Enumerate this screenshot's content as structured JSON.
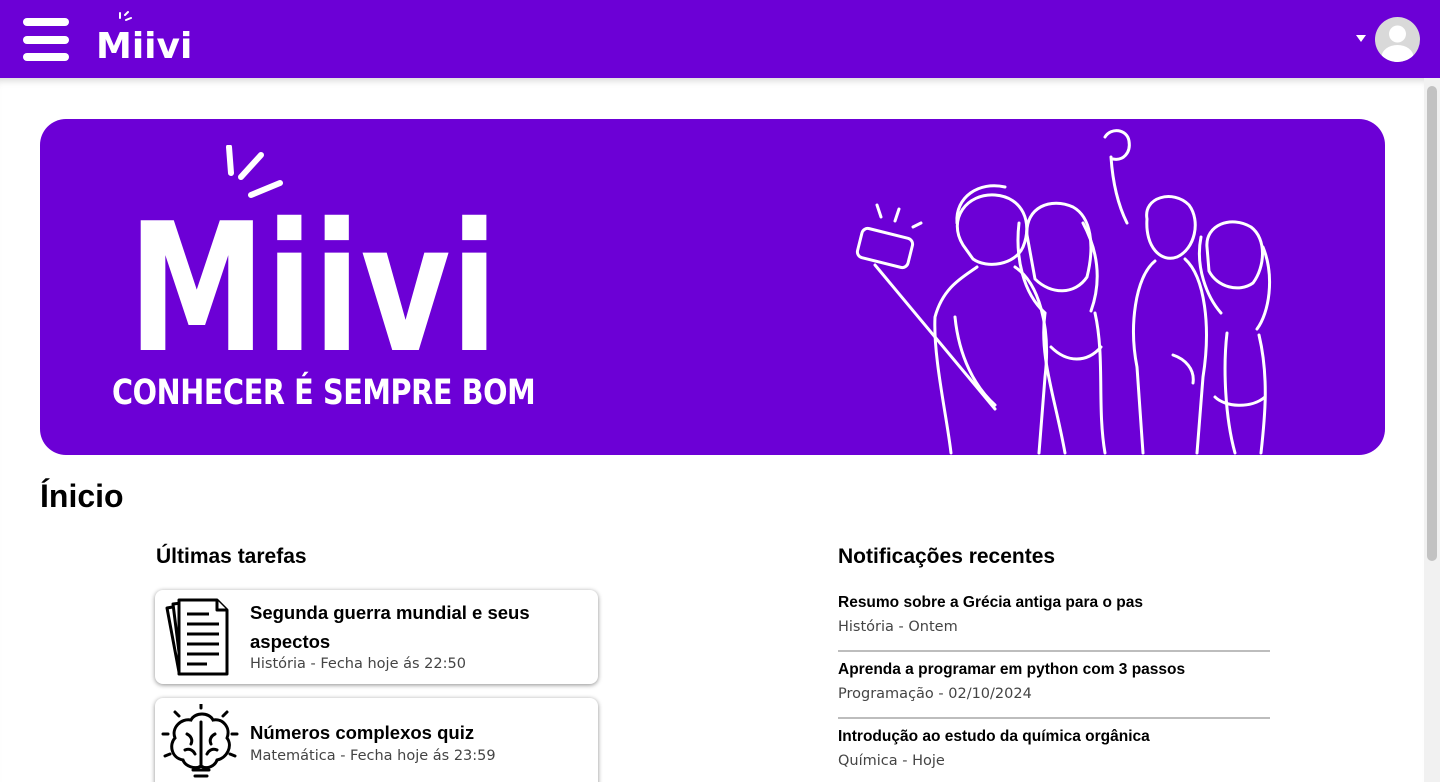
{
  "colors": {
    "brand": "#6c00d6",
    "text": "#111111",
    "muted": "#444444"
  },
  "header": {
    "menu_icon": "hamburger-menu-icon",
    "logo_text": "Miivi",
    "user_menu_icon": "caret-down-icon",
    "avatar_icon": "user-avatar-icon"
  },
  "banner": {
    "logo_text": "Miivi",
    "tagline": "CONHECER É SEMPRE BOM",
    "illustration": "friends-selfie-illustration"
  },
  "page_title": "Ínicio",
  "tasks": {
    "title": "Últimas tarefas",
    "items": [
      {
        "name": "Segunda guerra mundial e seus aspectos",
        "meta": "História - Fecha hoje ás 22:50",
        "icon": "document-icon"
      },
      {
        "name": "Números complexos quiz",
        "meta": "Matemática - Fecha hoje ás 23:59",
        "icon": "brain-idea-icon"
      }
    ]
  },
  "notifications": {
    "title": "Notificações recentes",
    "items": [
      {
        "title": "Resumo sobre a Grécia antiga para o pas",
        "meta": "História - Ontem"
      },
      {
        "title": "Aprenda a programar em python com 3 passos",
        "meta": "Programação - 02/10/2024"
      },
      {
        "title": "Introdução ao estudo da química orgânica",
        "meta": "Química - Hoje"
      }
    ]
  }
}
